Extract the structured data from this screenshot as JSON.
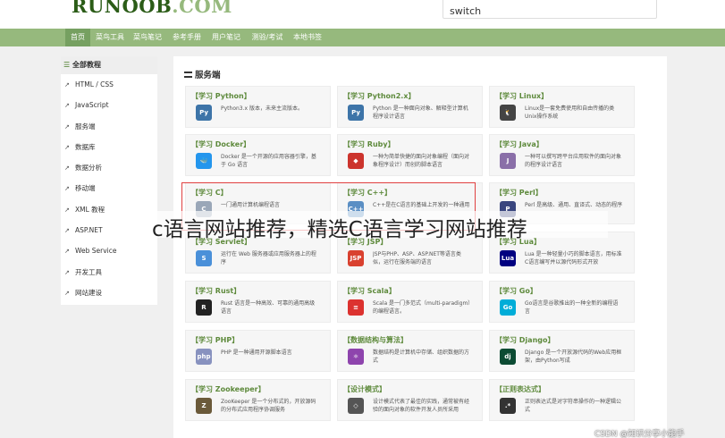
{
  "header": {
    "logo_main": "RUNOOB",
    "logo_suffix": ".COM",
    "search_value": "switch"
  },
  "nav": {
    "items": [
      "首页",
      "菜鸟工具",
      "菜鸟笔记",
      "参考手册",
      "用户笔记",
      "测验/考试",
      "本地书签"
    ],
    "active_index": 0
  },
  "sidebar": {
    "title": "全部教程",
    "items": [
      "HTML / CSS",
      "JavaScript",
      "服务端",
      "数据库",
      "数据分析",
      "移动端",
      "XML 教程",
      "ASP.NET",
      "Web Service",
      "开发工具",
      "网站建设"
    ]
  },
  "main": {
    "title": "服务端",
    "cards": [
      {
        "title": "【学习 Python】",
        "desc": "Python3.x 版本，未来主流版本。",
        "icon": "python-icon",
        "color": "#3d74a8"
      },
      {
        "title": "【学习 Python2.x】",
        "desc": "Python 是一种面向对象、解释型计算机\n程序设计语言",
        "icon": "python-icon",
        "color": "#3d74a8"
      },
      {
        "title": "【学习 Linux】",
        "desc": "Linux是一套免费使用和自由传播的类\nUnix操作系统",
        "icon": "linux-icon",
        "color": "#444444"
      },
      {
        "title": "【学习 Docker】",
        "desc": "Docker 是一个开源的应用容器引擎，基\n于 Go 语言",
        "icon": "docker-icon",
        "color": "#2496ed"
      },
      {
        "title": "【学习 Ruby】",
        "desc": "一种为简单快捷的面向对象编程（面向对\n象程序设计）而创的脚本语言",
        "icon": "ruby-icon",
        "color": "#cc342d"
      },
      {
        "title": "【学习 Java】",
        "desc": "一种可以撰写跨平台应用软件的面向对象\n的程序设计语言",
        "icon": "java-icon",
        "color": "#8a6fa8"
      },
      {
        "title": "【学习 C】",
        "desc": "一门通用计算机编程语言",
        "icon": "c-icon",
        "color": "#9aa7b8"
      },
      {
        "title": "【学习 C++】",
        "desc": "C++是在C语言的基础上开发的一种通用",
        "icon": "cpp-icon",
        "color": "#5b8fc4"
      },
      {
        "title": "【学习 Perl】",
        "desc": "Perl 是高级、通用、直译式、动态的程序",
        "icon": "perl-icon",
        "color": "#39457e"
      },
      {
        "title": "【学习 Servlet】",
        "desc": "运行在 Web 服务器或应用服务器上的程\n序",
        "icon": "servlet-icon",
        "color": "#4a90d9"
      },
      {
        "title": "【学习 JSP】",
        "desc": "JSP与PHP、ASP、ASP.NET等语言类\n似，运行在服务端的语言",
        "icon": "jsp-icon",
        "color": "#d9412f"
      },
      {
        "title": "【学习 Lua】",
        "desc": "Lua 是一种轻量小巧的脚本语言，用标准\nC语言编写并以源代码形式开放",
        "icon": "lua-icon",
        "color": "#000080"
      },
      {
        "title": "【学习 Rust】",
        "desc": "Rust 语言是一种高效、可靠的通用高级\n语言",
        "icon": "rust-icon",
        "color": "#222222"
      },
      {
        "title": "【学习 Scala】",
        "desc": "Scala 是一门多范式（multi-paradigm）\n的编程语言。",
        "icon": "scala-icon",
        "color": "#dc322f"
      },
      {
        "title": "【学习 Go】",
        "desc": "Go语言是谷歌推出的一种全新的编程语\n言",
        "icon": "go-icon",
        "color": "#00add8"
      },
      {
        "title": "【学习 PHP】",
        "desc": "PHP 是一种通用开源脚本语言",
        "icon": "php-icon",
        "color": "#8892bf"
      },
      {
        "title": "【数据结构与算法】",
        "desc": "数据结构是计算机中存储、组织数据的方\n式",
        "icon": "data-structure-icon",
        "color": "#8e44ad"
      },
      {
        "title": "【学习 Django】",
        "desc": "Django 是一个开放源代码的Web应用框\n架，由Python写成",
        "icon": "django-icon",
        "color": "#0c4b33"
      },
      {
        "title": "【学习 Zookeeper】",
        "desc": "ZooKeeper 是一个分布式的，开放源码\n的分布式应用程序协调服务",
        "icon": "zookeeper-icon",
        "color": "#6b5a3a"
      },
      {
        "title": "【设计模式】",
        "desc": "设计模式代表了最佳的实践，通常被有经\n验的面向对象的软件开发人员所采用",
        "icon": "design-pattern-icon",
        "color": "#555555"
      },
      {
        "title": "【正则表达式】",
        "desc": "正则表达式是对字符串操作的一种逻辑公\n式",
        "icon": "regex-icon",
        "color": "#333333"
      }
    ]
  },
  "overlay": {
    "caption": "c语言网站推荐，精选C语言学习网站推荐"
  },
  "watermark": "CSDN @知识分享小能手"
}
